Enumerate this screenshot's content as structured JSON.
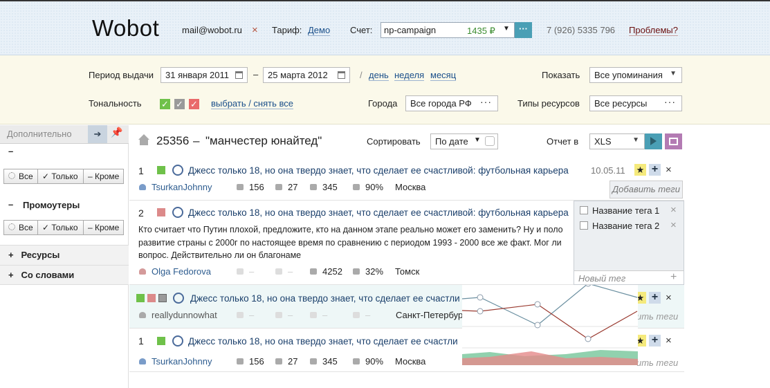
{
  "header": {
    "logo": "Wobot",
    "email": "mail@wobot.ru",
    "logout_icon": "×",
    "tariff_label": "Тариф:",
    "tariff_value": "Демо",
    "account_label": "Счет:",
    "account_name": "np-campaign",
    "account_sum": "1435 ₽",
    "account_more": "···",
    "phone": "7 (926) 5335 796",
    "problems": "Проблемы?"
  },
  "filters": {
    "period_label": "Период выдачи",
    "date_from": "31 января 2011",
    "date_sep": "–",
    "date_to": "25 марта 2012",
    "slash": "/",
    "day": "день",
    "week": "неделя",
    "month": "месяц",
    "show_label": "Показать",
    "show_value": "Все упоминания",
    "tone_label": "Тональность",
    "select_all": "выбрать / снять все",
    "cities_label": "Города",
    "cities_value": "Все города РФ",
    "types_label": "Типы ресурсов",
    "types_value": "Все ресурсы",
    "tone_colors": [
      "#6fc14a",
      "#9a9a9a",
      "#e96a6a"
    ]
  },
  "sidebar": {
    "title": "Дополнительно",
    "sec1_sign": "–",
    "seg_all": "Все",
    "seg_only": "Только",
    "seg_except": "Кроме",
    "sec2_title": "Промоутеры",
    "sec2_sign": "–",
    "resources": "Ресурсы",
    "with_words": "Со словами",
    "plus": "+"
  },
  "main": {
    "home_icon": "home-icon",
    "query_count": "25356",
    "query_dash": "–",
    "query_text": "\"манчестер юнайтед\"",
    "sort_label": "Сортировать",
    "sort_value": "По дате",
    "report_label": "Отчет в",
    "report_value": "XLS"
  },
  "rows": [
    {
      "num": "1",
      "color": "#6fc14a",
      "title": "Джесс только 18, но она твердо знает, что сделает ее счастливой: футбольная карьера",
      "date": "10.05.11",
      "user": "TsurkanJohnny",
      "comments": "156",
      "likes": "27",
      "rss": "345",
      "e": "90%",
      "city": "Москва",
      "add_tags": "Добавить теги"
    },
    {
      "num": "2",
      "color": "#dc8a8a",
      "title": "Джесс только 18, но она твердо знает, что сделает ее счастливой: футбольная карьера",
      "text1": "Кто считает что Путин плохой, предложите, кто на данном этапе реально может его заменить? Ну и поло",
      "text2": "развитие страны с 2000г по настоящее время по сравнению с периодом 1993 - 2000 все же факт. Мог ли",
      "text3": "вопрос. Действительно ли он благонаме",
      "user": "Olga Fedorova",
      "rss": "4252",
      "e": "32%",
      "city": "Томск"
    },
    {
      "colors": [
        "#6fc14a",
        "#dc8a8a",
        "#9a9a9a"
      ],
      "title": "Джесс только 18, но она твердо знает, что сделает ее счастли",
      "user": "reallydunnowhat",
      "dash": "–",
      "city": "Санкт-Петербур",
      "add_tags": "ить теги"
    },
    {
      "num": "1",
      "color": "#6fc14a",
      "title": "Джесс только 18, но она твердо знает, что сделает ее счастли",
      "user": "TsurkanJohnny",
      "comments": "156",
      "likes": "27",
      "rss": "345",
      "e": "90%",
      "city": "Москва",
      "add_tags": "ить теги"
    }
  ],
  "tag_popup": {
    "tags": [
      "Название тега 1",
      "Название тега 2"
    ],
    "new_tag_placeholder": "Новый тег",
    "remove": "×",
    "add": "+",
    "ghost1": "Ну и поло",
    "ghost2": "Мог ли"
  },
  "row_actions": {
    "star": "★",
    "plus": "+",
    "close": "×"
  },
  "chart_data": {
    "type": "line",
    "series": [
      {
        "color": "#6a8fa0",
        "values": [
          3,
          1,
          4,
          3
        ]
      },
      {
        "color": "#9a3a30",
        "values": [
          2,
          2.5,
          0,
          2
        ]
      }
    ],
    "area_colors": [
      "#7ec9a0",
      "#e58a8a"
    ]
  }
}
